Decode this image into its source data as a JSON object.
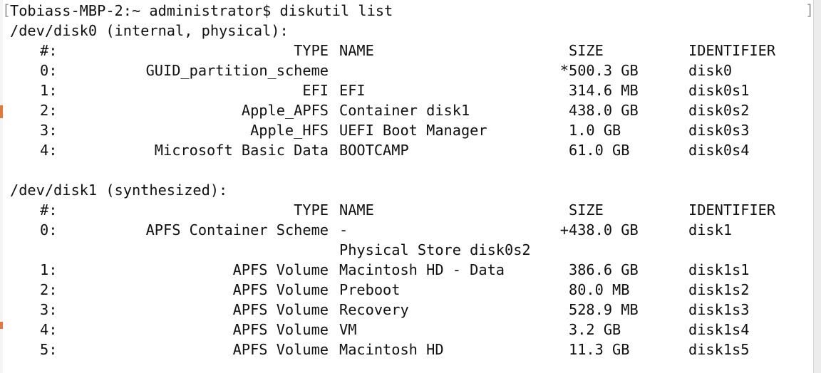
{
  "command_line": "Tobiass-MBP-2:~ administrator$ diskutil list",
  "headers": {
    "num": "#:",
    "type": "TYPE",
    "name": "NAME",
    "size": "SIZE",
    "identifier": "IDENTIFIER"
  },
  "disk0": {
    "title": "/dev/disk0 (internal, physical):",
    "rows": [
      {
        "num": "0:",
        "type": "GUID_partition_scheme",
        "name": "",
        "size_prefix": "*",
        "size": "500.3 GB",
        "identifier": "disk0"
      },
      {
        "num": "1:",
        "type": "EFI",
        "name": "EFI",
        "size_prefix": "",
        "size": "314.6 MB",
        "identifier": "disk0s1"
      },
      {
        "num": "2:",
        "type": "Apple_APFS",
        "name": "Container disk1",
        "size_prefix": "",
        "size": "438.0 GB",
        "identifier": "disk0s2"
      },
      {
        "num": "3:",
        "type": "Apple_HFS",
        "name": "UEFI Boot Manager",
        "size_prefix": "",
        "size": "1.0 GB",
        "identifier": "disk0s3"
      },
      {
        "num": "4:",
        "type": "Microsoft Basic Data",
        "name": "BOOTCAMP",
        "size_prefix": "",
        "size": "61.0 GB",
        "identifier": "disk0s4"
      }
    ]
  },
  "disk1": {
    "title": "/dev/disk1 (synthesized):",
    "rows": [
      {
        "num": "0:",
        "type": "APFS Container Scheme",
        "name": "-",
        "size_prefix": "+",
        "size": "438.0 GB",
        "identifier": "disk1",
        "name_cont": "Physical Store disk0s2"
      },
      {
        "num": "1:",
        "type": "APFS Volume",
        "name": "Macintosh HD - Data",
        "size_prefix": "",
        "size": "386.6 GB",
        "identifier": "disk1s1"
      },
      {
        "num": "2:",
        "type": "APFS Volume",
        "name": "Preboot",
        "size_prefix": "",
        "size": "80.0 MB",
        "identifier": "disk1s2"
      },
      {
        "num": "3:",
        "type": "APFS Volume",
        "name": "Recovery",
        "size_prefix": "",
        "size": "528.9 MB",
        "identifier": "disk1s3"
      },
      {
        "num": "4:",
        "type": "APFS Volume",
        "name": "VM",
        "size_prefix": "",
        "size": "3.2 GB",
        "identifier": "disk1s4"
      },
      {
        "num": "5:",
        "type": "APFS Volume",
        "name": "Macintosh HD",
        "size_prefix": "",
        "size": "11.3 GB",
        "identifier": "disk1s5"
      }
    ]
  }
}
